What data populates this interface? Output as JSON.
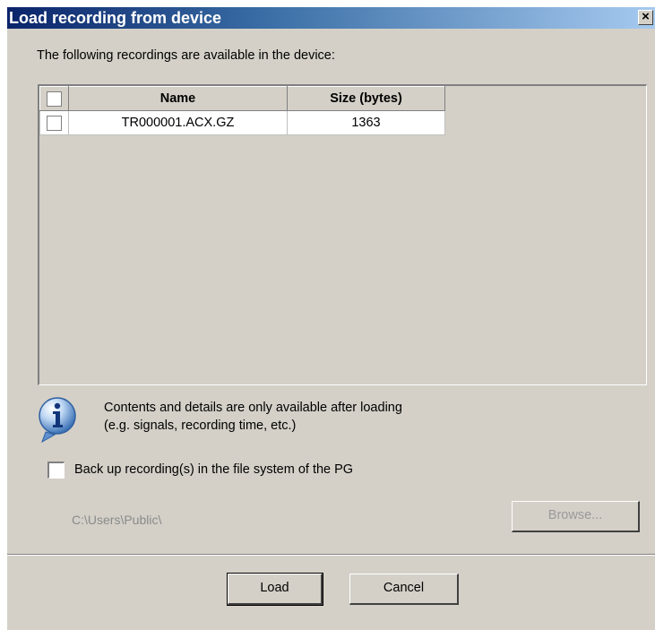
{
  "window": {
    "title": "Load recording from device",
    "close_glyph": "×"
  },
  "intro_text": "The following recordings are available in the device:",
  "recordings_table": {
    "columns": [
      "",
      "Name",
      "Size (bytes)"
    ],
    "rows": [
      {
        "checked": false,
        "name": "TR000001.ACX.GZ",
        "size": "1363"
      }
    ]
  },
  "info": {
    "icon": "info-icon",
    "line1": "Contents and details are only available after loading",
    "line2": "(e.g. signals, recording time, etc.)"
  },
  "backup": {
    "checked": false,
    "label": "Back up recording(s) in the file system of the PG",
    "path": "C:\\Users\\Public\\",
    "browse_label": "Browse..."
  },
  "buttons": {
    "load_label": "Load",
    "cancel_label": "Cancel"
  }
}
